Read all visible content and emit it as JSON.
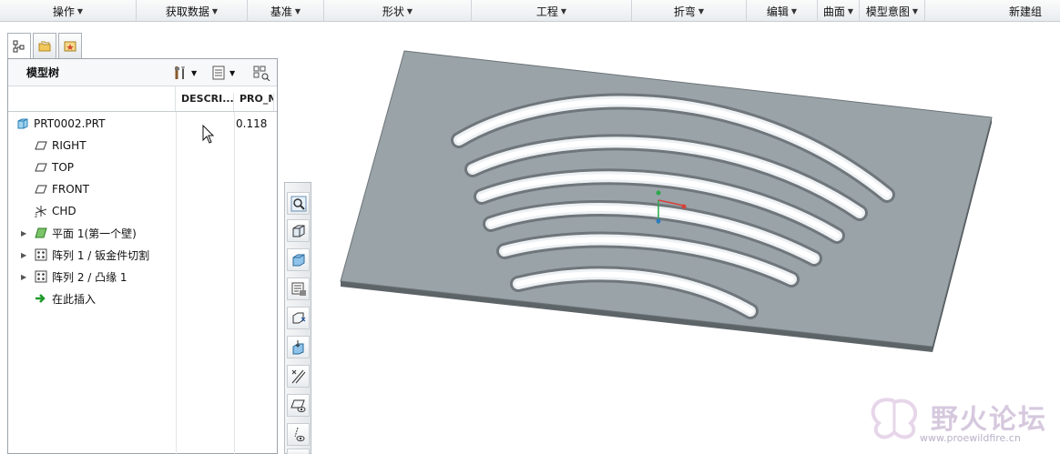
{
  "menubar": {
    "items": [
      {
        "label": "操作"
      },
      {
        "label": "获取数据"
      },
      {
        "label": "基准"
      },
      {
        "label": "形状"
      },
      {
        "label": "工程"
      },
      {
        "label": "折弯"
      },
      {
        "label": "编辑"
      },
      {
        "label": "曲面"
      },
      {
        "label": "模型意图"
      },
      {
        "label": "新建组"
      }
    ]
  },
  "tabs": [
    {
      "icon": "model-tree-icon"
    },
    {
      "icon": "folder-browser-icon"
    },
    {
      "icon": "favorites-icon"
    }
  ],
  "panel": {
    "title": "模型树",
    "columns": [
      "DESCRI...",
      "PRO_M"
    ]
  },
  "tree": {
    "items": [
      {
        "label": "PRT0002.PRT",
        "icon": "part-icon",
        "value": "0.118"
      },
      {
        "label": "RIGHT",
        "icon": "datum-plane-icon"
      },
      {
        "label": "TOP",
        "icon": "datum-plane-icon"
      },
      {
        "label": "FRONT",
        "icon": "datum-plane-icon"
      },
      {
        "label": "CHD",
        "icon": "coordinate-system-icon"
      },
      {
        "label": "平面 1(第一个壁)",
        "icon": "planar-wall-icon"
      },
      {
        "label": "阵列 1 / 钣金件切割",
        "icon": "pattern-icon"
      },
      {
        "label": "阵列 2 / 凸缘 1",
        "icon": "pattern-icon"
      },
      {
        "label": "在此插入",
        "icon": "insert-here-arrow-icon"
      }
    ]
  },
  "vtoolbar": {
    "buttons": [
      "zoom-icon",
      "view-orient-icon",
      "saved-views-icon",
      "view-manager-icon",
      "datum-plane-tool-icon",
      "datum-axis-tool-icon",
      "datum-point-tool-icon",
      "plane-display-icon",
      "axis-display-icon",
      "point-display-icon"
    ]
  },
  "watermark": {
    "text": "野火论坛",
    "url": "www.proewildfire.cn"
  },
  "colors": {
    "plate": "#9aa3a8",
    "plate_edge": "#5d6468",
    "accent": "#2e7bc4"
  }
}
